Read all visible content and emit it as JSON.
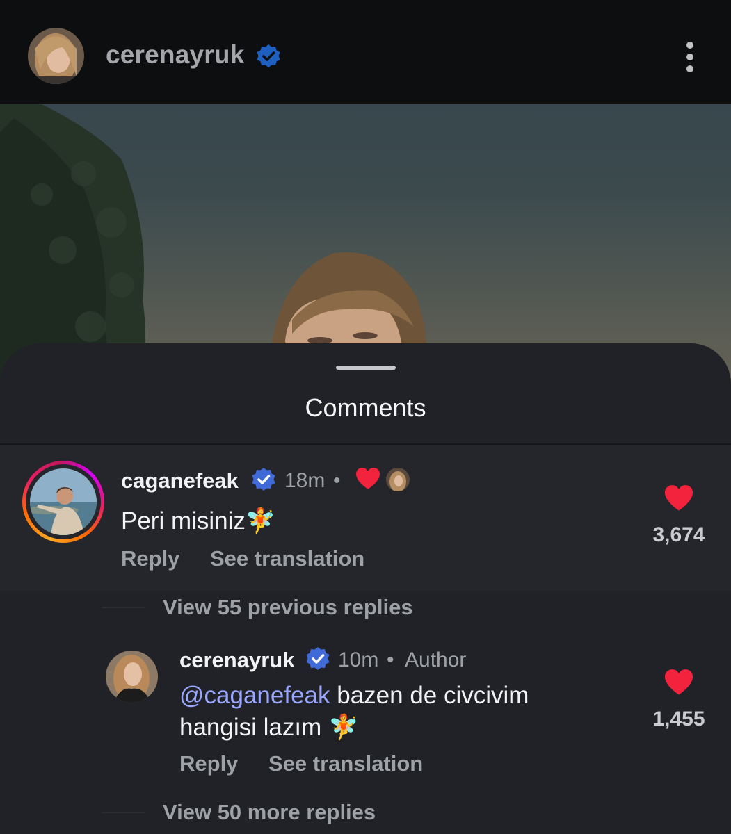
{
  "header": {
    "username": "cerenayruk",
    "verified_icon": "verified-badge-icon",
    "menu_icon": "more-vertical-icon"
  },
  "sheet": {
    "title": "Comments"
  },
  "comments": [
    {
      "username": "caganefeak",
      "time": "18m",
      "separator": "•",
      "liked_by_author_icon": "heart-icon",
      "body": "Peri misiniz",
      "emoji": "🧚",
      "like_count": "3,674",
      "reply_label": "Reply",
      "translate_label": "See translation"
    }
  ],
  "replies_prev": "View 55 previous replies",
  "reply": {
    "username": "cerenayruk",
    "time": "10m",
    "separator": "•",
    "role": "Author",
    "mention": "@caganefeak",
    "body_line1": " bazen de civcivim",
    "body_line2": "hangisi lazım ",
    "emoji": "🧚",
    "like_count": "1,455",
    "reply_label": "Reply",
    "translate_label": "See translation"
  },
  "replies_more": "View 50 more replies",
  "colors": {
    "background": "#202227",
    "verified": "#3f6ad8",
    "like": "#f3223d",
    "mention": "#9aa7ff",
    "story_ring": "#e91e63"
  }
}
